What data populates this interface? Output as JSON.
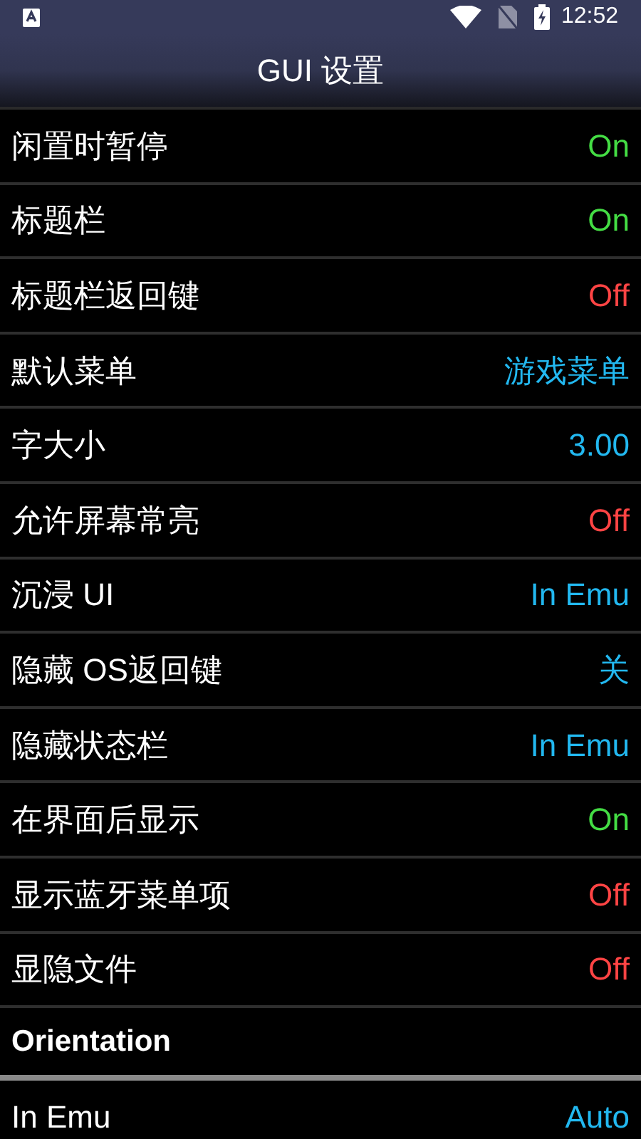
{
  "status_bar": {
    "time": "12:52"
  },
  "title": "GUI 设置",
  "items": [
    {
      "kind": "setting",
      "label": "闲置时暂停",
      "value": "On",
      "color": "#44dd44"
    },
    {
      "kind": "setting",
      "label": "标题栏",
      "value": "On",
      "color": "#44dd44"
    },
    {
      "kind": "setting",
      "label": "标题栏返回键",
      "value": "Off",
      "color": "#ff4444"
    },
    {
      "kind": "setting",
      "label": "默认菜单",
      "value": "游戏菜单",
      "color": "#22b8f0"
    },
    {
      "kind": "setting",
      "label": "字大小",
      "value": "3.00",
      "color": "#22b8f0"
    },
    {
      "kind": "setting",
      "label": "允许屏幕常亮",
      "value": "Off",
      "color": "#ff4444"
    },
    {
      "kind": "setting",
      "label": "沉浸 UI",
      "value": "In Emu",
      "color": "#22b8f0"
    },
    {
      "kind": "setting",
      "label": "隐藏 OS返回键",
      "value": "关",
      "color": "#22b8f0"
    },
    {
      "kind": "setting",
      "label": "隐藏状态栏",
      "value": "In Emu",
      "color": "#22b8f0"
    },
    {
      "kind": "setting",
      "label": "在界面后显示",
      "value": "On",
      "color": "#44dd44"
    },
    {
      "kind": "setting",
      "label": "显示蓝牙菜单项",
      "value": "Off",
      "color": "#ff4444"
    },
    {
      "kind": "setting",
      "label": "显隐文件",
      "value": "Off",
      "color": "#ff4444"
    },
    {
      "kind": "header",
      "label": "Orientation"
    },
    {
      "kind": "setting",
      "label": "In Emu",
      "value": "Auto",
      "color": "#22b8f0"
    }
  ]
}
